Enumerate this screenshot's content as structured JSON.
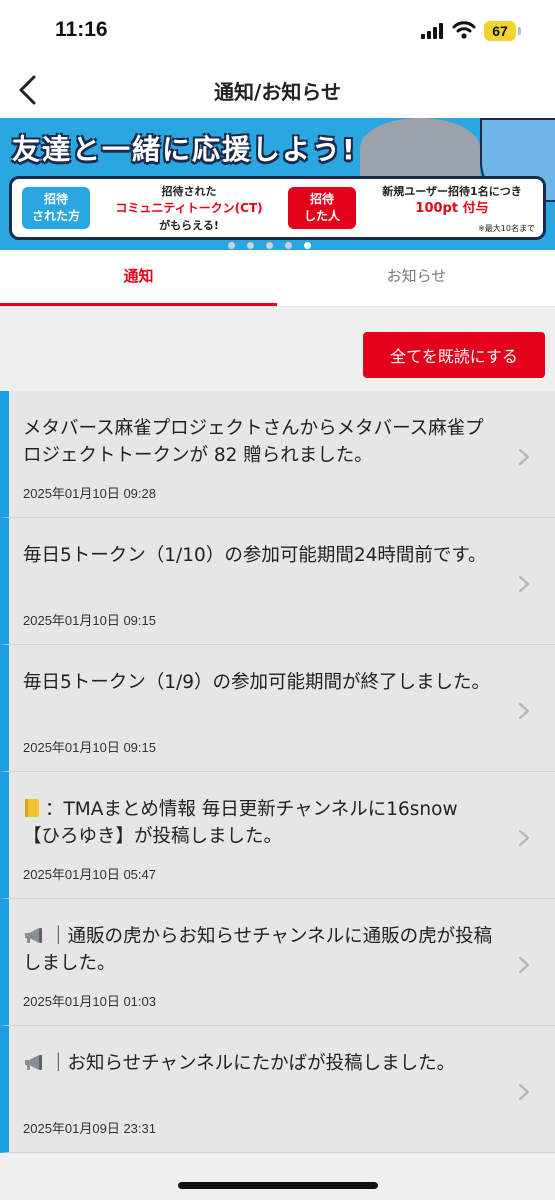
{
  "status": {
    "time": "11:16",
    "battery": "67"
  },
  "nav": {
    "title": "通知/お知らせ"
  },
  "banner": {
    "headline": "友達と一緒に応援しよう!",
    "left_pill": [
      "招待",
      "された方"
    ],
    "left_lines": [
      "招待された",
      "コミュニティトークン(CT)",
      "がもらえる!"
    ],
    "right_pill": [
      "招待",
      "した人"
    ],
    "right_lines": [
      "新規ユーザー招待1名につき",
      "100pt 付与"
    ],
    "note": "※最大10名まで"
  },
  "tabs": [
    {
      "label": "通知"
    },
    {
      "label": "お知らせ"
    }
  ],
  "actions": {
    "mark_all_read": "全てを既読にする"
  },
  "notifications": [
    {
      "icon": "",
      "text": "メタバース麻雀プロジェクトさんからメタバース麻雀プロジェクトトークンが 82 贈られました。",
      "date": "2025年01月10日 09:28"
    },
    {
      "icon": "",
      "text": "毎日5トークン（1/10）の参加可能期間24時間前です。",
      "date": "2025年01月10日 09:15"
    },
    {
      "icon": "",
      "text": "毎日5トークン（1/9）の参加可能期間が終了しました。",
      "date": "2025年01月10日 09:15"
    },
    {
      "icon": "notebook-icon",
      "text": "：TMAまとめ情報 毎日更新チャンネルに16snow【ひろゆき】が投稿しました。",
      "date": "2025年01月10日 05:47"
    },
    {
      "icon": "megaphone-icon",
      "text": "｜通販の虎からお知らせチャンネルに通販の虎が投稿しました。",
      "date": "2025年01月10日 01:03"
    },
    {
      "icon": "megaphone-icon",
      "text": "｜お知らせチャンネルにたかばが投稿しました。",
      "date": "2025年01月09日 23:31"
    }
  ]
}
